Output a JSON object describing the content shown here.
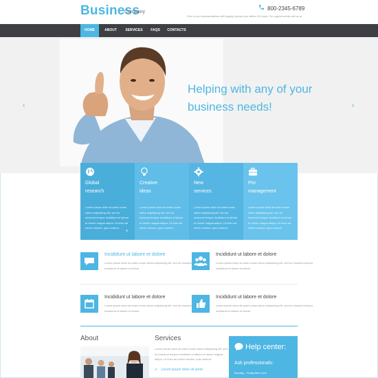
{
  "colors": {
    "accent": "#4db6e3",
    "nav_bg": "#3d3f42",
    "feature_blues": [
      "#4aaedb",
      "#5fbde8",
      "#55b6e3",
      "#69c3ec"
    ]
  },
  "header": {
    "logo": "Business",
    "logo_sub": "Company",
    "phone": "800-2345-6789",
    "tagline": "One of our representatives will happily contact you within 24 hours. For urgent needs call us at"
  },
  "nav": {
    "items": [
      "HOME",
      "ABOUT",
      "SERVICES",
      "FAQS",
      "CONTACTS"
    ]
  },
  "hero": {
    "title_line1": "Helping with any of your",
    "title_line2": "business needs!",
    "prev_icon": "chevron-left-icon",
    "next_icon": "chevron-right-icon"
  },
  "features": [
    {
      "line1": "Global",
      "line2": "research",
      "icon": "globe-icon",
      "text": "Lorem ipsum dolor sit amet conse ctetur adipisicing elit, sed do eiusmod tempor incididunt ut labore et dolore magna aliqua. Ut enim ad minim veniam, quis nostrud."
    },
    {
      "line1": "Creative",
      "line2": "ideas",
      "icon": "lightbulb-icon",
      "text": "Lorem ipsum dolor sit amet conse ctetur adipisicing elit, sed do eiusmod tempor incididunt ut labore et dolore magna aliqua. Ut enim ad minim veniam, quis nostrud."
    },
    {
      "line1": "New",
      "line2": "services",
      "icon": "gear-icon",
      "text": "Lorem ipsum dolor sit amet conse ctetur adipisicing elit, sed do eiusmod tempor incididunt ut labore et dolore magna aliqua. Ut enim ad minim veniam, quis nostrud."
    },
    {
      "line1": "Pro",
      "line2": "management",
      "icon": "briefcase-icon",
      "text": "Lorem ipsum dolor sit amet conse ctetur adipisicing elit, sed do eiusmod tempor incididunt ut labore et dolore magna aliqua. Ut enim ad minim veniam, quis nostrud."
    }
  ],
  "info_items": [
    {
      "title": "Incididunt ut labore et dolore",
      "icon": "chat-icon",
      "text": "Lorem ipsum dolor sit amet conse ctetur adipisicing elit, sed do eiusmod tempor incididunt ut labore et dolore."
    },
    {
      "title": "Incididunt ut labore et dolore",
      "icon": "users-icon",
      "text": "Lorem ipsum dolor sit amet conse ctetur adipisicing elit, sed do eiusmod tempor incididunt ut labore et dolore."
    },
    {
      "title": "Incididunt ut labore et dolore",
      "icon": "calendar-icon",
      "text": "Lorem ipsum dolor sit amet conse ctetur adipisicing elit, sed do eiusmod tempor incididunt ut labore et dolore."
    },
    {
      "title": "Incididunt ut labore et dolore",
      "icon": "thumbs-up-icon",
      "text": "Lorem ipsum dolor sit amet conse ctetur adipisicing elit, sed do eiusmod tempor incididunt ut labore et dolore."
    }
  ],
  "bottom": {
    "about_title": "About",
    "services_title": "Services",
    "services_text": "Lorem ipsum dolor sit amet conse ctetur adipisicing elit, sed do eiusmod tempor incididunt ut labore et dolore magna aliqua. Ut enim ad minim veniam, quis nostrud.",
    "services_link": "Lorem ipsum dolor sit amet",
    "help_title": "Help center:",
    "help_sub": "Ask professionals:",
    "help_hours": "Monday - Friday 8am-7pm"
  }
}
